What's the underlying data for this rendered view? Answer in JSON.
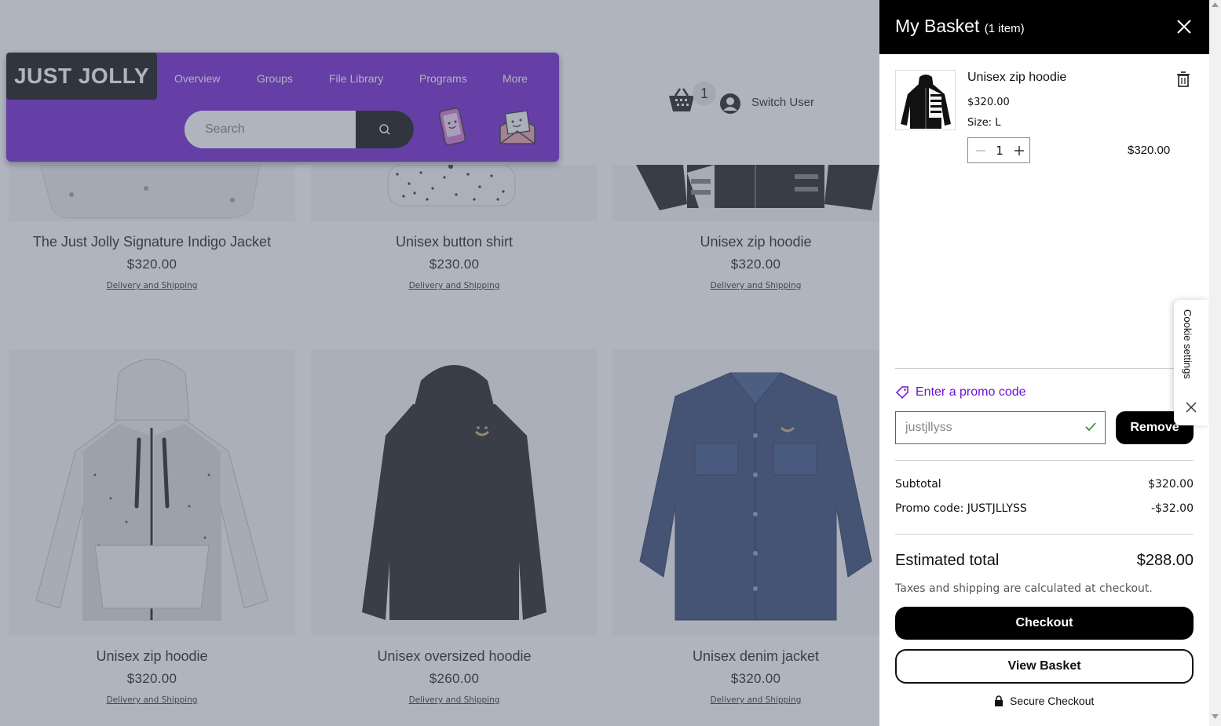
{
  "header": {
    "logo": "JUST JOLLY",
    "nav": [
      "Overview",
      "Groups",
      "File Library",
      "Programs",
      "More"
    ],
    "search_placeholder": "Search"
  },
  "top_bar": {
    "cart_count": "1",
    "switch_user": "Switch User"
  },
  "products": [
    {
      "name": "The Just Jolly Signature Indigo Jacket",
      "price": "$320.00",
      "shipping": "Delivery and Shipping"
    },
    {
      "name": "Unisex button shirt",
      "price": "$230.00",
      "shipping": "Delivery and Shipping"
    },
    {
      "name": "Unisex zip hoodie",
      "price": "$320.00",
      "shipping": "Delivery and Shipping"
    },
    {
      "name": "Unisex zip hoodie",
      "price": "$320.00",
      "shipping": "Delivery and Shipping"
    },
    {
      "name": "Unisex oversized hoodie",
      "price": "$260.00",
      "shipping": "Delivery and Shipping"
    },
    {
      "name": "Unisex denim jacket",
      "price": "$320.00",
      "shipping": "Delivery and Shipping"
    }
  ],
  "basket": {
    "title": "My Basket",
    "count_text": "(1 item)",
    "item": {
      "name": "Unisex zip hoodie",
      "price": "$320.00",
      "size": "Size: L",
      "quantity": "1",
      "total": "$320.00"
    },
    "promo_link": "Enter a promo code",
    "promo_code_value": "justjllyss",
    "remove_label": "Remove",
    "subtotal_label": "Subtotal",
    "subtotal_value": "$320.00",
    "promo_label": "Promo code: JUSTJLLYSS",
    "promo_value": "-$32.00",
    "estimated_label": "Estimated total",
    "estimated_value": "$288.00",
    "taxes_note": "Taxes and shipping are calculated at checkout.",
    "checkout_label": "Checkout",
    "view_basket_label": "View Basket",
    "secure_label": "Secure Checkout"
  },
  "cookie": {
    "label": "Cookie settings"
  },
  "colors": {
    "header_purple": "#6a12cf",
    "promo_accent": "#6a12cf",
    "promo_border": "#1a8a3a",
    "overlay": "#5f6a7d"
  }
}
